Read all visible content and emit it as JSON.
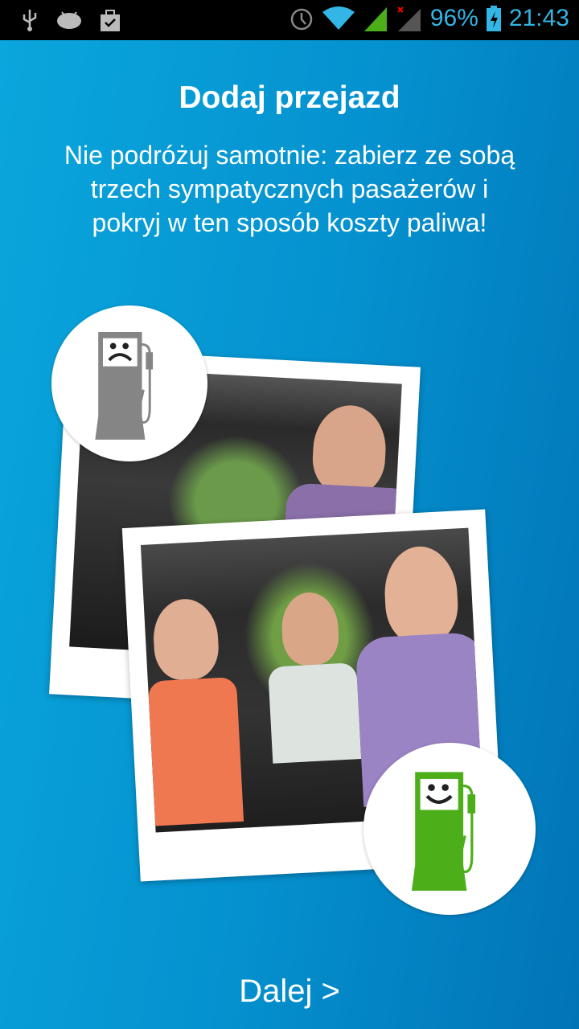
{
  "status_bar": {
    "battery": "96%",
    "time": "21:43"
  },
  "title": "Dodaj przejazd",
  "description": "Nie podróżuj samotnie: zabierz ze sobą trzech sympatycznych pasażerów i pokryj w ten sposób koszty paliwa!",
  "next_button": "Dalej >",
  "colors": {
    "sad_pump": "#858585",
    "happy_pump": "#4caf1a",
    "accent": "#33b5e5"
  }
}
